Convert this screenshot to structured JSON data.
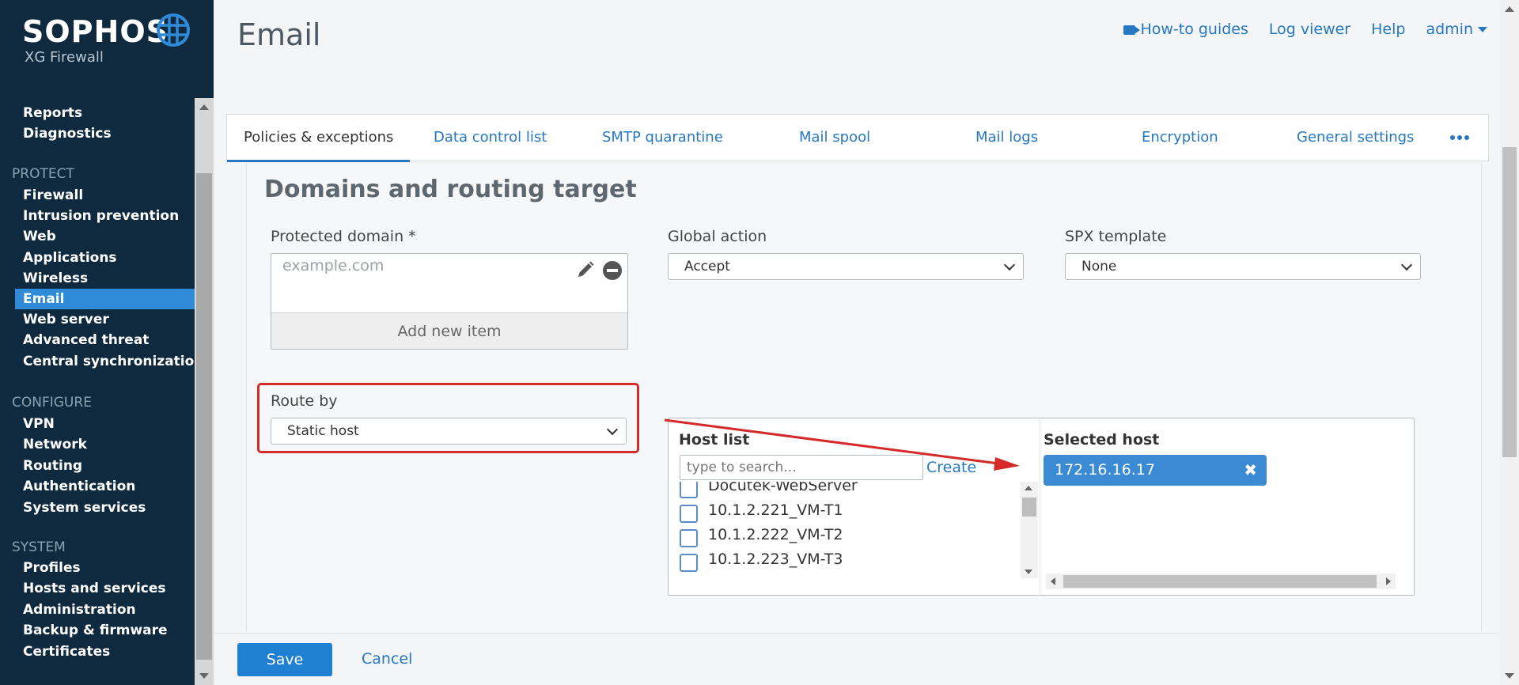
{
  "brand": {
    "name": "SOPHOS",
    "product": "XG Firewall"
  },
  "page": {
    "title": "Email"
  },
  "header": {
    "links": [
      {
        "label": "How-to guides",
        "icon": "video-camera-icon"
      },
      {
        "label": "Log viewer"
      },
      {
        "label": "Help"
      },
      {
        "label": "admin",
        "icon": "caret-down-icon"
      }
    ]
  },
  "sidebar": {
    "top_items": [
      "Reports",
      "Diagnostics"
    ],
    "groups": [
      {
        "title": "PROTECT",
        "items": [
          "Firewall",
          "Intrusion prevention",
          "Web",
          "Applications",
          "Wireless",
          "Email",
          "Web server",
          "Advanced threat",
          "Central synchronization"
        ]
      },
      {
        "title": "CONFIGURE",
        "items": [
          "VPN",
          "Network",
          "Routing",
          "Authentication",
          "System services"
        ]
      },
      {
        "title": "SYSTEM",
        "items": [
          "Profiles",
          "Hosts and services",
          "Administration",
          "Backup & firmware",
          "Certificates"
        ]
      }
    ],
    "active_item": "Email"
  },
  "tabs": [
    "Policies & exceptions",
    "Data control list",
    "SMTP quarantine",
    "Mail spool",
    "Mail logs",
    "Encryption",
    "General settings"
  ],
  "active_tab": "Policies & exceptions",
  "section": {
    "title": "Domains and routing target",
    "protected_domain": {
      "label": "Protected domain *",
      "placeholder": "example.com",
      "add_label": "Add new item"
    },
    "global_action": {
      "label": "Global action",
      "value": "Accept"
    },
    "spx_template": {
      "label": "SPX template",
      "value": "None"
    },
    "route_by": {
      "label": "Route by",
      "value": "Static host"
    },
    "host_list": {
      "title": "Host list",
      "search_placeholder": "type to search...",
      "create_label": "Create",
      "items": [
        "Docutek-WebServer",
        "10.1.2.221_VM-T1",
        "10.1.2.222_VM-T2",
        "10.1.2.223_VM-T3"
      ]
    },
    "selected_host": {
      "title": "Selected host",
      "value": "172.16.16.17"
    }
  },
  "footer": {
    "save_label": "Save",
    "cancel_label": "Cancel"
  },
  "colors": {
    "sidebar_bg": "#0f2a3e",
    "accent": "#2678c2",
    "active_nav": "#2f8ad7",
    "highlight": "#d42a2a",
    "chip": "#3a8bd3"
  }
}
